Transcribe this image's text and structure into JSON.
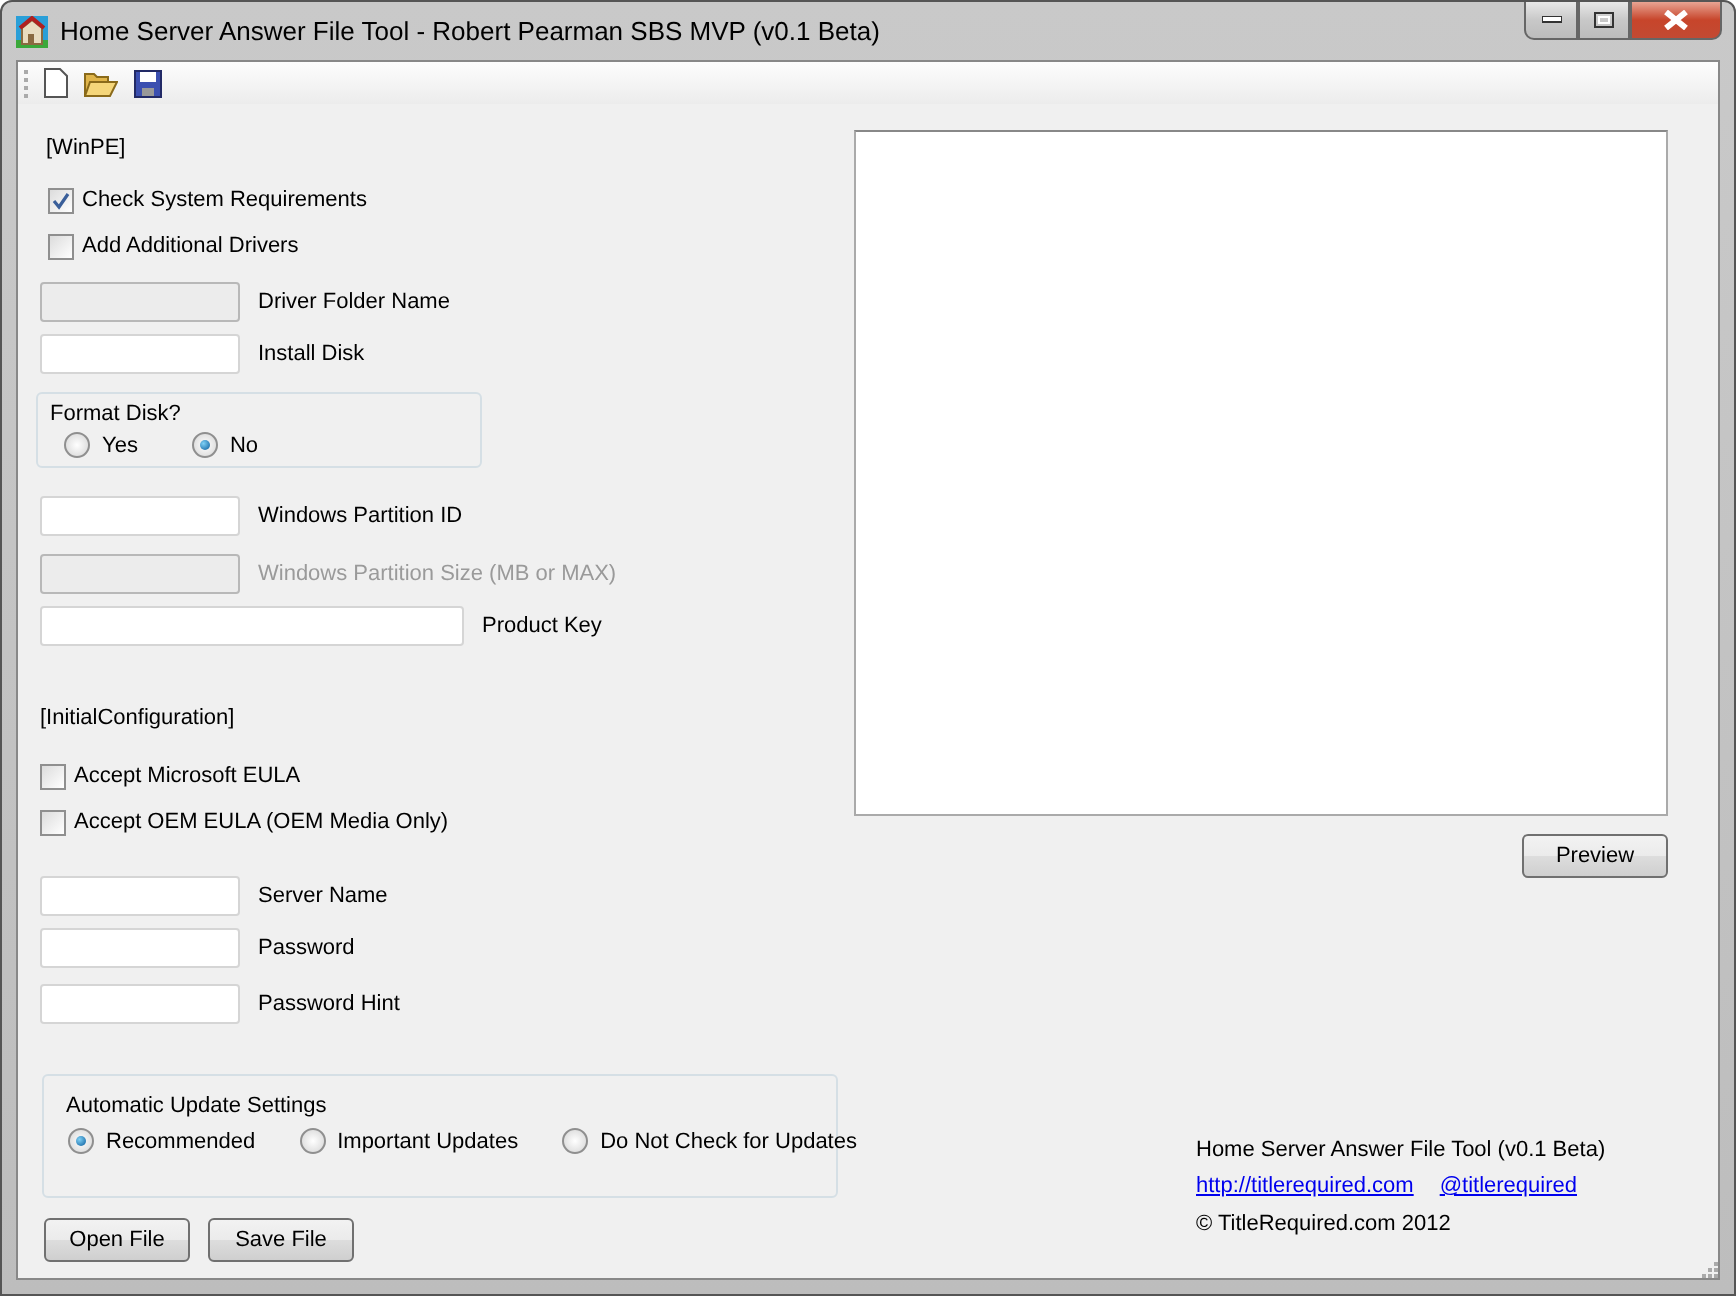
{
  "window": {
    "title": "Home Server Answer File Tool - Robert Pearman SBS MVP (v0.1 Beta)"
  },
  "winpe": {
    "heading": "[WinPE]",
    "checkboxes": [
      {
        "label": "Check System Requirements",
        "checked": true
      },
      {
        "label": "Add Additional Drivers",
        "checked": false
      }
    ],
    "fields": [
      {
        "label": "Driver Folder Name",
        "disabled": true,
        "label_greyed": false,
        "kind": "short"
      },
      {
        "label": "Install Disk",
        "disabled": false,
        "label_greyed": false,
        "kind": "short"
      }
    ],
    "format_disk": {
      "title": "Format Disk?",
      "options": [
        {
          "label": "Yes",
          "selected": false
        },
        {
          "label": "No",
          "selected": true
        }
      ]
    },
    "fields_2": [
      {
        "label": "Windows Partition ID",
        "disabled": false,
        "label_greyed": false,
        "kind": "short"
      },
      {
        "label": "Windows Partition Size (MB or MAX)",
        "disabled": true,
        "label_greyed": true,
        "kind": "short"
      },
      {
        "label": "Product Key",
        "disabled": false,
        "label_greyed": false,
        "kind": "long"
      }
    ]
  },
  "initial_configuration": {
    "heading": "[InitialConfiguration]",
    "checkboxes": [
      {
        "label": "Accept Microsoft EULA",
        "checked": false
      },
      {
        "label": "Accept OEM EULA (OEM Media Only)",
        "checked": false
      }
    ],
    "fields": [
      {
        "label": "Server Name",
        "disabled": false,
        "label_greyed": false,
        "kind": "short"
      },
      {
        "label": "Password",
        "disabled": false,
        "label_greyed": false,
        "kind": "short"
      },
      {
        "label": "Password Hint",
        "disabled": false,
        "label_greyed": false,
        "kind": "short"
      }
    ]
  },
  "update_settings": {
    "title": "Automatic Update Settings",
    "options": [
      {
        "label": "Recommended",
        "selected": true
      },
      {
        "label": "Important Updates",
        "selected": false
      },
      {
        "label": "Do Not Check for Updates",
        "selected": false
      }
    ]
  },
  "buttons": [
    "Open File",
    "Save File"
  ],
  "preview": {
    "button": "Preview"
  },
  "footer": {
    "title": "Home Server Answer File Tool  (v0.1 Beta)",
    "links": [
      "http://titlerequired.com",
      "@titlerequired"
    ],
    "copyright": "© TitleRequired.com 2012"
  }
}
